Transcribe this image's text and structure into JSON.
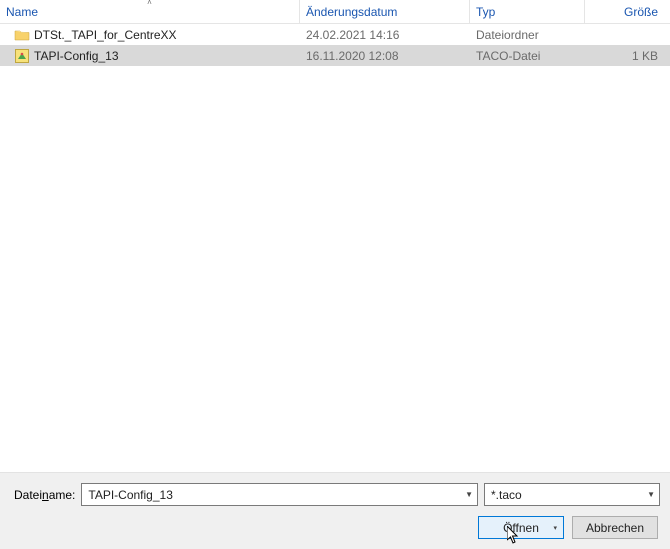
{
  "headers": {
    "name": "Name",
    "date": "Änderungsdatum",
    "type": "Typ",
    "size": "Größe"
  },
  "rows": [
    {
      "name": "DTSt._TAPI_for_CentreXX",
      "date": "24.02.2021 14:16",
      "type": "Dateiordner",
      "size": ""
    },
    {
      "name": "TAPI-Config_13",
      "date": "16.11.2020 12:08",
      "type": "TACO-Datei",
      "size": "1 KB"
    }
  ],
  "footer": {
    "filename_label_pre": "Datei",
    "filename_label_ul": "n",
    "filename_label_post": "ame:",
    "filename_value": "TAPI-Config_13",
    "filter_value": "*.taco",
    "open": "Öffnen",
    "cancel": "Abbrechen"
  }
}
